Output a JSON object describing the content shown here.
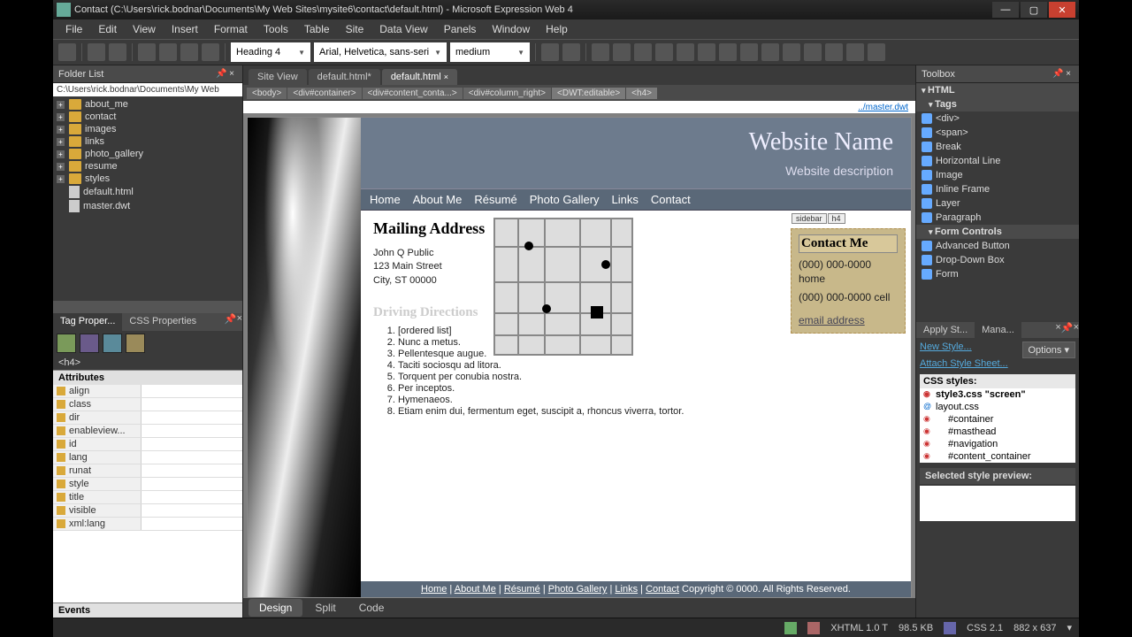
{
  "window": {
    "title": "Contact (C:\\Users\\rick.bodnar\\Documents\\My Web Sites\\mysite6\\contact\\default.html) - Microsoft Expression Web 4"
  },
  "menubar": [
    "File",
    "Edit",
    "View",
    "Insert",
    "Format",
    "Tools",
    "Table",
    "Site",
    "Data View",
    "Panels",
    "Window",
    "Help"
  ],
  "toolbar": {
    "style_sel": "Heading 4",
    "font_sel": "Arial, Helvetica, sans-seri",
    "size_sel": "medium"
  },
  "folder_list": {
    "title": "Folder List",
    "path": "C:\\Users\\rick.bodnar\\Documents\\My Web",
    "items": [
      {
        "name": "about_me",
        "type": "folder"
      },
      {
        "name": "contact",
        "type": "folder"
      },
      {
        "name": "images",
        "type": "folder"
      },
      {
        "name": "links",
        "type": "folder"
      },
      {
        "name": "photo_gallery",
        "type": "folder"
      },
      {
        "name": "resume",
        "type": "folder"
      },
      {
        "name": "styles",
        "type": "folder"
      },
      {
        "name": "default.html",
        "type": "file"
      },
      {
        "name": "master.dwt",
        "type": "file"
      }
    ]
  },
  "tag_properties": {
    "tabs": [
      "Tag Proper...",
      "CSS Properties"
    ],
    "path": "<h4>",
    "section": "Attributes",
    "attrs": [
      "align",
      "class",
      "dir",
      "enableview...",
      "id",
      "lang",
      "runat",
      "style",
      "title",
      "visible",
      "xml:lang"
    ],
    "section2": "Events"
  },
  "doc_tabs": [
    "Site View",
    "default.html*",
    "default.html"
  ],
  "breadcrumb": [
    "<body>",
    "<div#container>",
    "<div#content_conta...>",
    "<div#column_right>",
    "<DWT:editable>",
    "<h4>"
  ],
  "master_link": "../master.dwt",
  "page": {
    "site_name": "Website Name",
    "site_desc": "Website description",
    "nav": [
      "Home",
      "About Me",
      "Résumé",
      "Photo Gallery",
      "Links",
      "Contact"
    ],
    "mail_h": "Mailing Address",
    "addr1": "John Q Public",
    "addr2": "123 Main Street",
    "addr3": "City, ST 00000",
    "dir_h": "Driving Directions",
    "dirs": [
      "[ordered list]",
      "Nunc a metus.",
      "Pellentesque augue.",
      "Taciti sociosqu ad litora.",
      "Torquent per conubia nostra.",
      "Per inceptos.",
      "Hymenaeos.",
      "Etiam enim dui, fermentum eget, suscipit a, rhoncus viverra, tortor."
    ],
    "sidebar_tag1": "sidebar",
    "sidebar_tag2": "h4",
    "contact_h": "Contact Me",
    "phone1": "(000) 000-0000 home",
    "phone2": "(000) 000-0000 cell",
    "email": "email address",
    "footer_nav": [
      "Home",
      "About Me",
      "Résumé",
      "Photo Gallery",
      "Links",
      "Contact"
    ],
    "footer_copy": "Copyright © 0000. All Rights Reserved."
  },
  "view_tabs": [
    "Design",
    "Split",
    "Code"
  ],
  "toolbox": {
    "title": "Toolbox",
    "cat_html": "HTML",
    "cat_tags": "Tags",
    "tags": [
      "<div>",
      "<span>",
      "Break",
      "Horizontal Line",
      "Image",
      "Inline Frame",
      "Layer",
      "Paragraph"
    ],
    "cat_form": "Form Controls",
    "form": [
      "Advanced Button",
      "Drop-Down Box",
      "Form"
    ]
  },
  "styles": {
    "tabs": [
      "Apply St...",
      "Mana..."
    ],
    "new_style": "New Style...",
    "options": "Options",
    "attach": "Attach Style Sheet...",
    "css_hdr": "CSS styles:",
    "rows": [
      {
        "t": "style3.css \"screen\"",
        "b": true,
        "at": false
      },
      {
        "t": "layout.css",
        "b": false,
        "at": true
      },
      {
        "t": "#container",
        "b": false,
        "at": false
      },
      {
        "t": "#masthead",
        "b": false,
        "at": false
      },
      {
        "t": "#navigation",
        "b": false,
        "at": false
      },
      {
        "t": "#content_container",
        "b": false,
        "at": false
      }
    ],
    "preview_lbl": "Selected style preview:"
  },
  "statusbar": {
    "doctype": "XHTML 1.0 T",
    "size": "98.5 KB",
    "css": "CSS 2.1",
    "dim": "882 x 637"
  }
}
